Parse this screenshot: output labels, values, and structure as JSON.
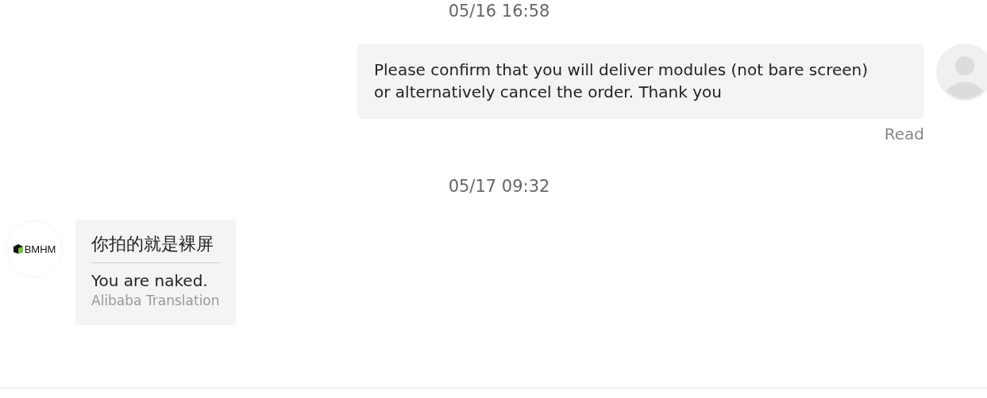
{
  "messages": [
    {
      "kind": "timestamp",
      "text": "05/16 16:58"
    },
    {
      "kind": "outgoing",
      "lines": [
        "Please confirm that you will deliver modules (not bare screen)",
        "or alternatively cancel the order. Thank you"
      ],
      "status": "Read"
    },
    {
      "kind": "timestamp",
      "text": "05/17 09:32"
    },
    {
      "kind": "incoming",
      "avatar_logo": "BMHM",
      "original": "你拍的就是裸屏",
      "translation": "You are naked.",
      "translation_source": "Alibaba Translation"
    }
  ]
}
